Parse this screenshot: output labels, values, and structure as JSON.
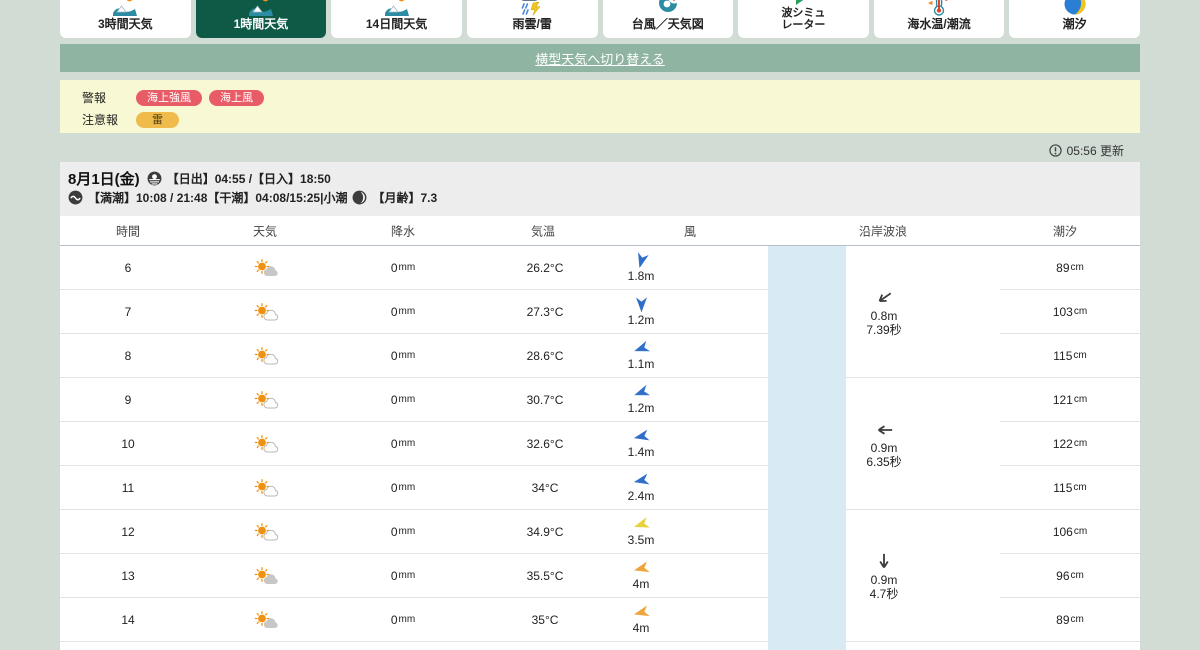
{
  "page": {
    "bg": "#d0dcd4",
    "panel_bg": "#ffffff"
  },
  "tabs": {
    "selected_bg": "#0e5a47",
    "items": [
      {
        "key": "3h-weather",
        "label": "3時間天気",
        "icon": "weather-scene",
        "selected": false
      },
      {
        "key": "1h-weather",
        "label": "1時間天気",
        "icon": "weather-scene",
        "selected": true
      },
      {
        "key": "14d-weather",
        "label": "14日間天気",
        "icon": "weather-scene",
        "selected": false
      },
      {
        "key": "rain-radar",
        "label": "雨雲/雷",
        "icon": "rain-lightning",
        "selected": false
      },
      {
        "key": "typhoon-map",
        "label": "台風／天気図",
        "icon": "typhoon",
        "selected": false
      },
      {
        "key": "wave-sim",
        "label": "波シミュ",
        "label2": "レーター",
        "icon": "wave-sim",
        "selected": false
      },
      {
        "key": "sea-temp",
        "label": "海水温/潮流",
        "icon": "sea-temp",
        "selected": false
      },
      {
        "key": "tide",
        "label": "潮汐",
        "icon": "tide-moon",
        "selected": false
      }
    ]
  },
  "switch_link": {
    "label": "横型天気へ切り替える",
    "bg": "#8fb4a2"
  },
  "alerts": {
    "bg": "#f8f8d4",
    "warning_label": "警報",
    "warning_badges": [
      "海上強風",
      "海上風"
    ],
    "warning_color": "#e85c68",
    "advisory_label": "注意報",
    "advisory_badges": [
      "雷"
    ],
    "advisory_color": "#efbc4c"
  },
  "update": {
    "text": "05:56 更新"
  },
  "date_header": {
    "date": "8月1日(金)",
    "sun_info": "【日出】04:55 /【日入】18:50",
    "tide_info": "【満潮】10:08 / 21:48【干潮】04:08/15:25|小潮",
    "moon_info": "【月齢】7.3"
  },
  "table": {
    "headers": [
      "時間",
      "天気",
      "降水",
      "気温",
      "風",
      "沿岸波浪",
      "潮汐"
    ],
    "wave_band_color": "#d8eaf4",
    "rows": [
      {
        "hour": "6",
        "weather": "sun-cloud-gray",
        "precip": "0",
        "precip_unit": "mm",
        "temp": "26.2°C",
        "wind": {
          "speed": "1.8m",
          "deg": 195,
          "color": "blue"
        },
        "tide": "89",
        "tide_unit": "cm"
      },
      {
        "hour": "7",
        "weather": "sun-cloud-white",
        "precip": "0",
        "precip_unit": "mm",
        "temp": "27.3°C",
        "wind": {
          "speed": "1.2m",
          "deg": 180,
          "color": "blue"
        },
        "tide": "103",
        "tide_unit": "cm"
      },
      {
        "hour": "8",
        "weather": "sun-cloud-white",
        "precip": "0",
        "precip_unit": "mm",
        "temp": "28.6°C",
        "wind": {
          "speed": "1.1m",
          "deg": 250,
          "color": "blue"
        },
        "tide": "115",
        "tide_unit": "cm"
      },
      {
        "hour": "9",
        "weather": "sun-cloud-white",
        "precip": "0",
        "precip_unit": "mm",
        "temp": "30.7°C",
        "wind": {
          "speed": "1.2m",
          "deg": 250,
          "color": "blue"
        },
        "tide": "121",
        "tide_unit": "cm"
      },
      {
        "hour": "10",
        "weather": "sun-cloud-white",
        "precip": "0",
        "precip_unit": "mm",
        "temp": "32.6°C",
        "wind": {
          "speed": "1.4m",
          "deg": 258,
          "color": "blue"
        },
        "tide": "122",
        "tide_unit": "cm"
      },
      {
        "hour": "11",
        "weather": "sun-cloud-white",
        "precip": "0",
        "precip_unit": "mm",
        "temp": "34°C",
        "wind": {
          "speed": "2.4m",
          "deg": 258,
          "color": "blue"
        },
        "tide": "115",
        "tide_unit": "cm"
      },
      {
        "hour": "12",
        "weather": "sun-cloud-white",
        "precip": "0",
        "precip_unit": "mm",
        "temp": "34.9°C",
        "wind": {
          "speed": "3.5m",
          "deg": 252,
          "color": "yellow"
        },
        "tide": "106",
        "tide_unit": "cm"
      },
      {
        "hour": "13",
        "weather": "sun-cloud-gray",
        "precip": "0",
        "precip_unit": "mm",
        "temp": "35.5°C",
        "wind": {
          "speed": "4m",
          "deg": 256,
          "color": "orange"
        },
        "tide": "96",
        "tide_unit": "cm"
      },
      {
        "hour": "14",
        "weather": "sun-cloud-gray",
        "precip": "0",
        "precip_unit": "mm",
        "temp": "35°C",
        "wind": {
          "speed": "4m",
          "deg": 256,
          "color": "orange"
        },
        "tide": "89",
        "tide_unit": "cm"
      }
    ],
    "wave_cells": [
      {
        "dir": "sw",
        "height": "0.8m",
        "period": "7.39秒"
      },
      {
        "dir": "w",
        "height": "0.9m",
        "period": "6.35秒"
      },
      {
        "dir": "s",
        "height": "0.9m",
        "period": "4.7秒"
      }
    ]
  },
  "colors": {
    "wind": {
      "blue": "#2f6fc8",
      "yellow": "#e8d23a",
      "orange": "#f0a43c"
    }
  }
}
